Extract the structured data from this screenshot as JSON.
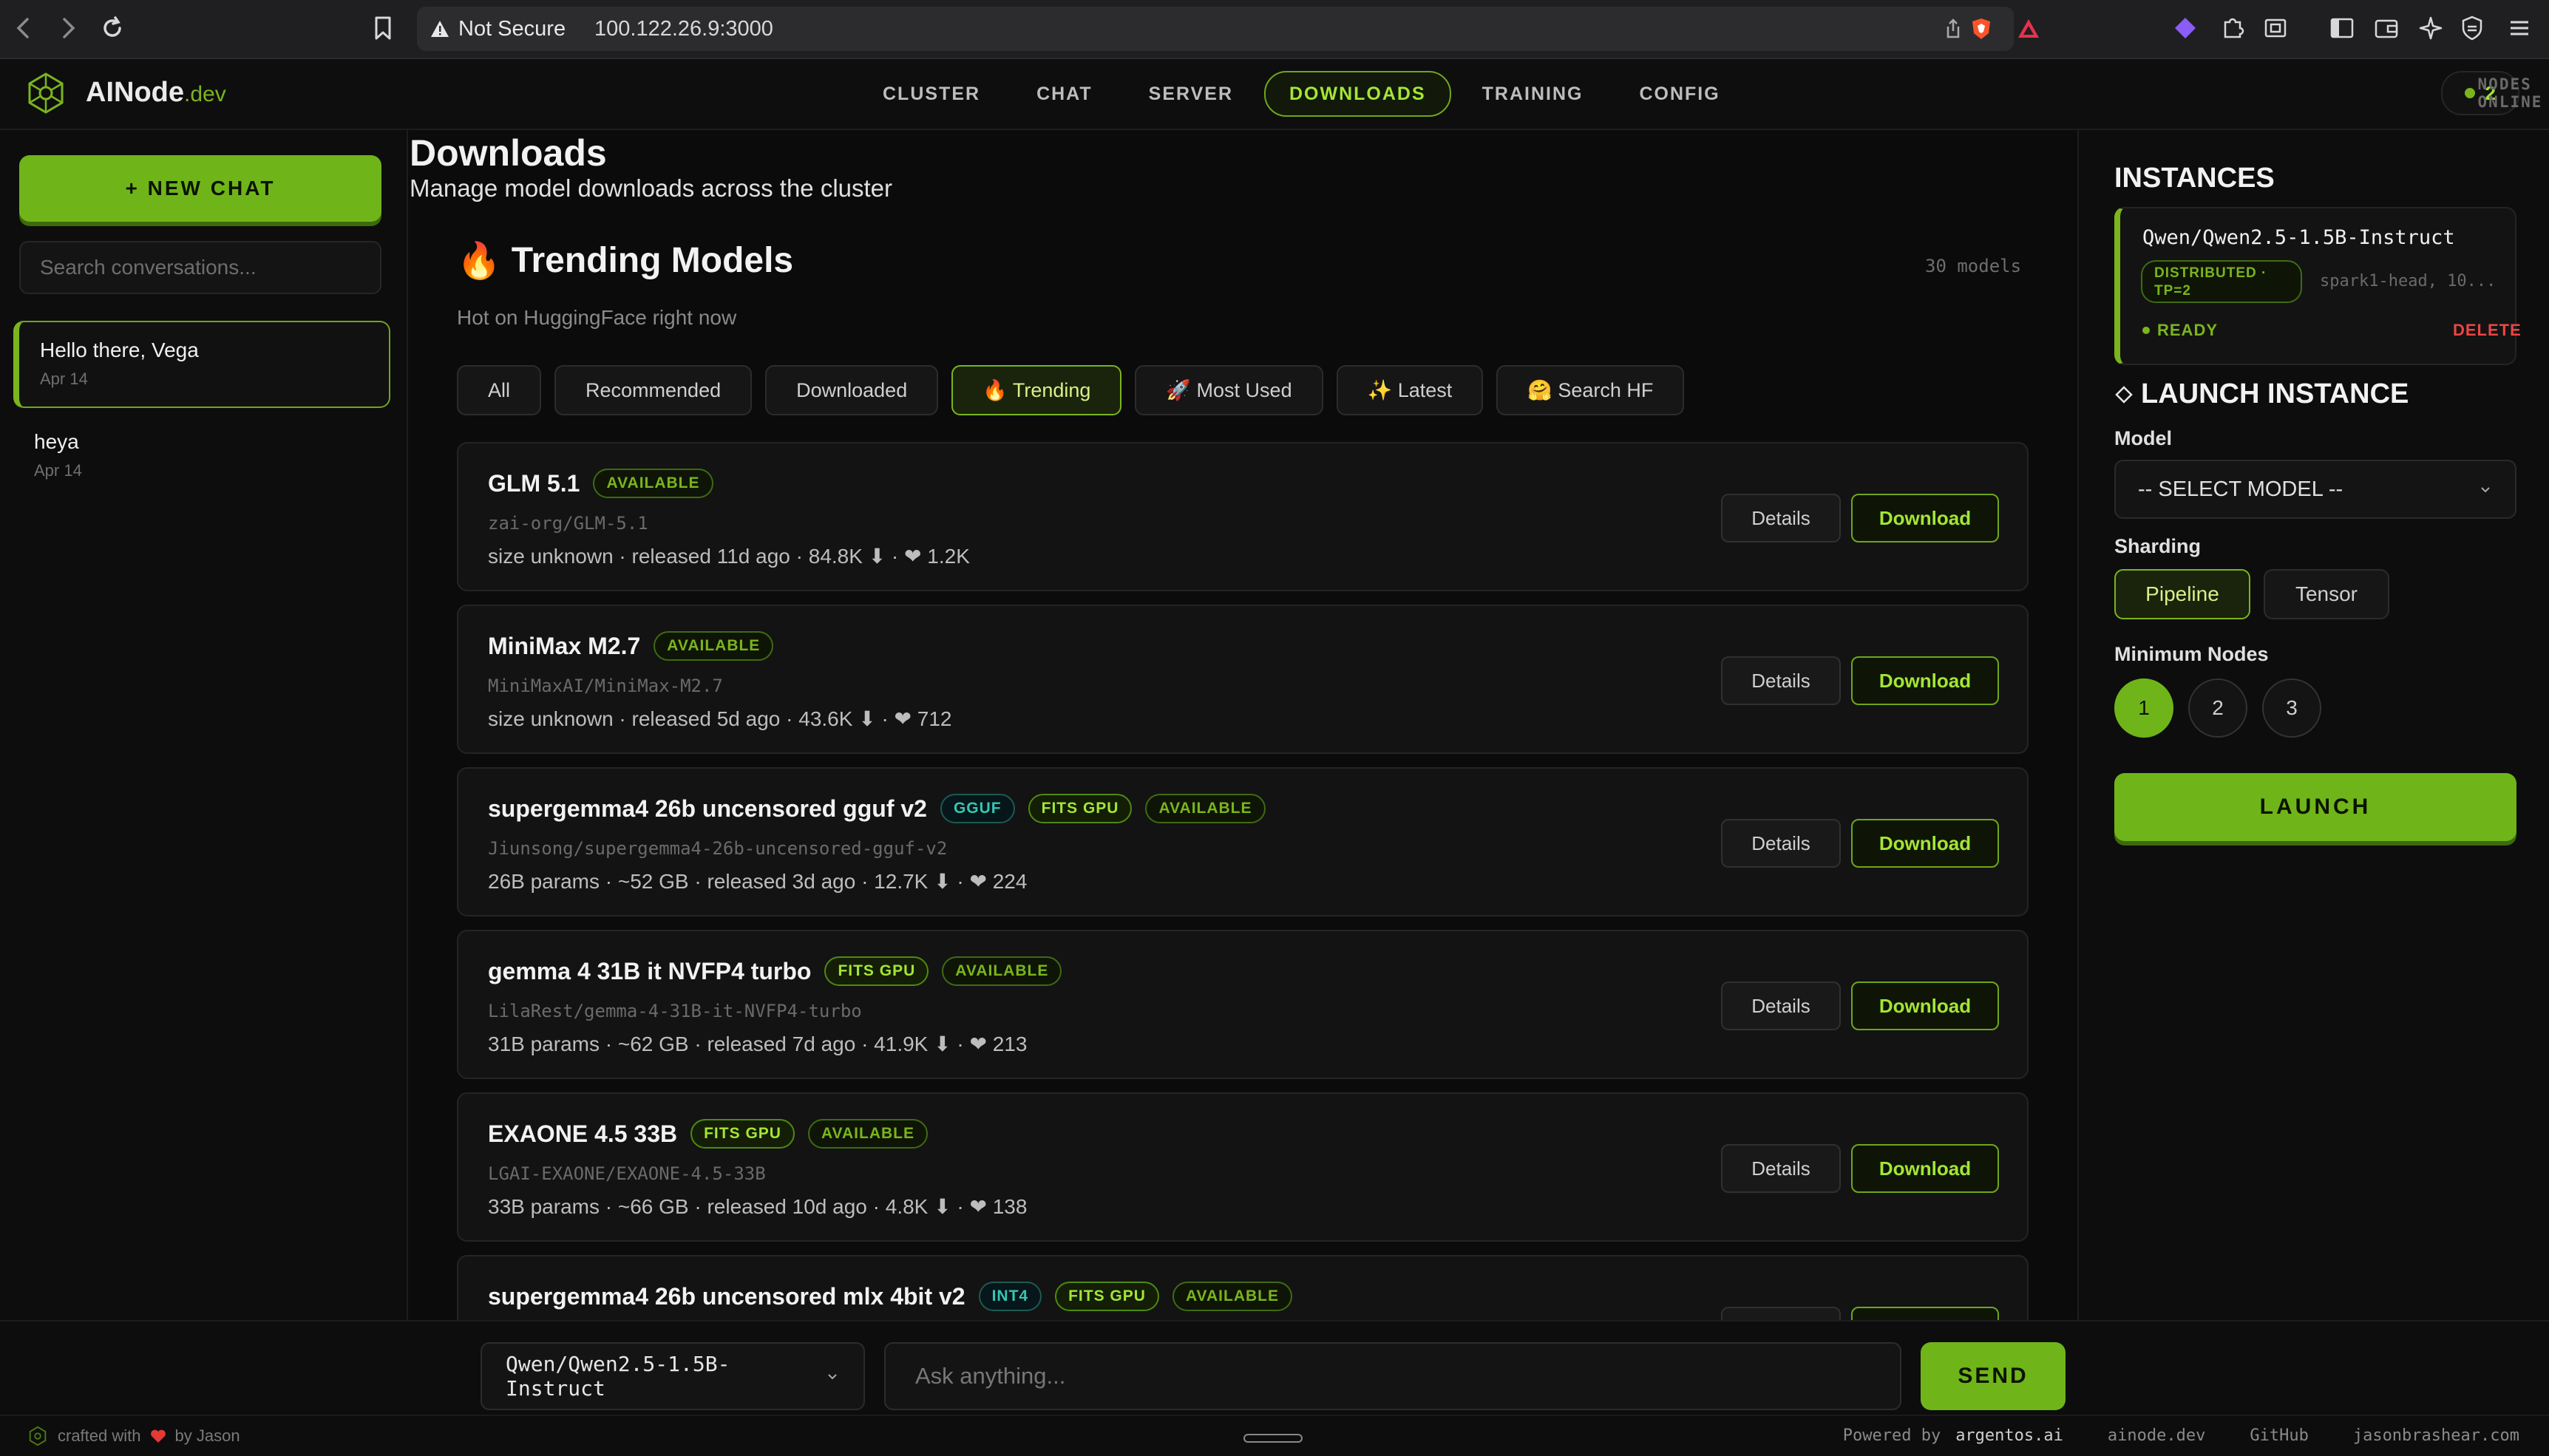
{
  "browser": {
    "security_label": "Not Secure",
    "url": "100.122.26.9:3000"
  },
  "header": {
    "logo_name": "AINode",
    "logo_suffix": ".dev",
    "nav": [
      "CLUSTER",
      "CHAT",
      "SERVER",
      "DOWNLOADS",
      "TRAINING",
      "CONFIG"
    ],
    "active_nav": "DOWNLOADS",
    "nodes_count": "2",
    "nodes_label": "NODES ONLINE"
  },
  "sidebar": {
    "new_chat_label": "+ NEW CHAT",
    "search_placeholder": "Search conversations...",
    "conversations": [
      {
        "title": "Hello there, Vega",
        "date": "Apr 14"
      },
      {
        "title": "heya",
        "date": "Apr 14"
      }
    ]
  },
  "main": {
    "title": "Downloads",
    "subtitle": "Manage model downloads across the cluster",
    "section_icon": "🔥",
    "section_title": "Trending Models",
    "section_count": "30 models",
    "section_subtitle": "Hot on HuggingFace right now",
    "filters": [
      "All",
      "Recommended",
      "Downloaded",
      "🔥 Trending",
      "🚀 Most Used",
      "✨ Latest",
      "🤗 Search HF"
    ],
    "active_filter": "🔥 Trending",
    "details_label": "Details",
    "download_label": "Download",
    "models": [
      {
        "name": "GLM 5.1",
        "badges": [
          {
            "text": "AVAILABLE",
            "kind": "available"
          }
        ],
        "repo": "zai-org/GLM-5.1",
        "meta": "size unknown · released 11d ago · 84.8K ⬇ · ❤ 1.2K"
      },
      {
        "name": "MiniMax M2.7",
        "badges": [
          {
            "text": "AVAILABLE",
            "kind": "available"
          }
        ],
        "repo": "MiniMaxAI/MiniMax-M2.7",
        "meta": "size unknown · released 5d ago · 43.6K ⬇ · ❤ 712"
      },
      {
        "name": "supergemma4 26b uncensored gguf v2",
        "badges": [
          {
            "text": "GGUF",
            "kind": "gguf"
          },
          {
            "text": "FITS GPU",
            "kind": "fits"
          },
          {
            "text": "AVAILABLE",
            "kind": "available"
          }
        ],
        "repo": "Jiunsong/supergemma4-26b-uncensored-gguf-v2",
        "meta": "26B params · ~52 GB · released 3d ago · 12.7K ⬇ · ❤ 224"
      },
      {
        "name": "gemma 4 31B it NVFP4 turbo",
        "badges": [
          {
            "text": "FITS GPU",
            "kind": "fits"
          },
          {
            "text": "AVAILABLE",
            "kind": "available"
          }
        ],
        "repo": "LilaRest/gemma-4-31B-it-NVFP4-turbo",
        "meta": "31B params · ~62 GB · released 7d ago · 41.9K ⬇ · ❤ 213"
      },
      {
        "name": "EXAONE 4.5 33B",
        "badges": [
          {
            "text": "FITS GPU",
            "kind": "fits"
          },
          {
            "text": "AVAILABLE",
            "kind": "available"
          }
        ],
        "repo": "LGAI-EXAONE/EXAONE-4.5-33B",
        "meta": "33B params · ~66 GB · released 10d ago · 4.8K ⬇ · ❤ 138"
      },
      {
        "name": "supergemma4 26b uncensored mlx 4bit v2",
        "badges": [
          {
            "text": "INT4",
            "kind": "int4"
          },
          {
            "text": "FITS GPU",
            "kind": "fits"
          },
          {
            "text": "AVAILABLE",
            "kind": "available"
          }
        ],
        "repo": "",
        "meta": ""
      }
    ]
  },
  "right_panel": {
    "instances_title": "INSTANCES",
    "instance": {
      "name": "Qwen/Qwen2.5-1.5B-Instruct",
      "tag_line1": "DISTRIBUTED ·",
      "tag_line2": "TP=2",
      "host": "spark1-head, 10...",
      "status": "READY",
      "delete_label": "DELETE"
    },
    "launch_title": "LAUNCH INSTANCE",
    "model_label": "Model",
    "model_placeholder": "-- SELECT MODEL --",
    "sharding_label": "Sharding",
    "sharding_options": [
      "Pipeline",
      "Tensor"
    ],
    "active_sharding": "Pipeline",
    "min_nodes_label": "Minimum Nodes",
    "node_options": [
      "1",
      "2",
      "3"
    ],
    "active_nodes": "1",
    "launch_label": "LAUNCH"
  },
  "chatbar": {
    "selected_model": "Qwen/Qwen2.5-1.5B-Instruct",
    "ask_placeholder": "Ask anything...",
    "send_label": "SEND"
  },
  "footer": {
    "crafted_prefix": "crafted with",
    "crafted_suffix": "by Jason",
    "powered_label": "Powered by",
    "powered_name": "argentos.ai",
    "links": [
      "ainode.dev",
      "GitHub",
      "jasonbrashear.com"
    ]
  },
  "colors": {
    "accent": "#7ab51d",
    "accent_bright": "#a3e635",
    "danger": "#ef4444",
    "teal_badge": "#35c7b2"
  },
  "icons": {
    "back": "chevron-left-icon",
    "forward": "chevron-right-icon",
    "reload": "reload-icon",
    "bookmark": "bookmark-icon",
    "warning": "warning-triangle-icon",
    "share": "share-icon",
    "brave": "brave-shield-icon",
    "rewards": "brave-rewards-icon",
    "logo": "network-node-icon",
    "select_arrow": "chevron-down-icon",
    "diamond": "diamond-icon",
    "heart": "heart-icon"
  }
}
